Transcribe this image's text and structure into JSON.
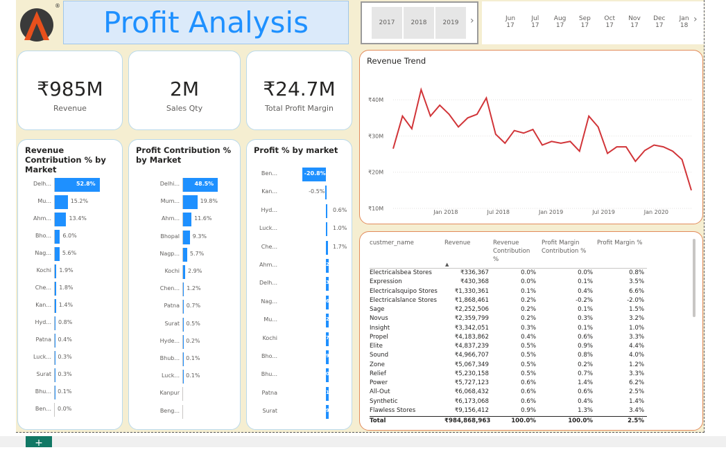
{
  "header": {
    "title": "Profit Analysis",
    "logo_letter": "A",
    "logo_mark": "®"
  },
  "year_slicer": {
    "years": [
      "2017",
      "2018",
      "2019"
    ],
    "next_icon": "chevron-right-icon"
  },
  "month_slicer": {
    "months": [
      [
        "Jun",
        "17"
      ],
      [
        "Jul",
        "17"
      ],
      [
        "Aug",
        "17"
      ],
      [
        "Sep",
        "17"
      ],
      [
        "Oct",
        "17"
      ],
      [
        "Nov",
        "17"
      ],
      [
        "Dec",
        "17"
      ],
      [
        "Jan",
        "18"
      ]
    ],
    "next_icon": "chevron-right-icon"
  },
  "kpis": [
    {
      "value": "₹985M",
      "label": "Revenue"
    },
    {
      "value": "2M",
      "label": "Sales Qty"
    },
    {
      "value": "₹24.7M",
      "label": "Total Profit Margin"
    }
  ],
  "revenue_contribution": {
    "title": "Revenue Contribution % by Market",
    "categories": [
      "Delh...",
      "Mu...",
      "Ahm...",
      "Bho...",
      "Nag...",
      "Kochi",
      "Che...",
      "Kan...",
      "Hyd...",
      "Patna",
      "Luck...",
      "Surat",
      "Bhu...",
      "Ben..."
    ],
    "labels": [
      "52.8%",
      "15.2%",
      "13.4%",
      "6.0%",
      "5.6%",
      "1.9%",
      "1.8%",
      "1.4%",
      "0.8%",
      "0.4%",
      "0.3%",
      "0.3%",
      "0.1%",
      "0.0%"
    ],
    "values": [
      52.8,
      15.2,
      13.4,
      6.0,
      5.6,
      1.9,
      1.8,
      1.4,
      0.8,
      0.4,
      0.3,
      0.3,
      0.1,
      0.0
    ]
  },
  "profit_contribution": {
    "title": "Profit Contribution % by Market",
    "categories": [
      "Delhi...",
      "Mum...",
      "Ahm...",
      "Bhopal",
      "Nagp...",
      "Kochi",
      "Chen...",
      "Patna",
      "Surat",
      "Hyde...",
      "Bhub...",
      "Luck...",
      "Kanpur",
      "Beng..."
    ],
    "labels": [
      "48.5%",
      "19.8%",
      "11.6%",
      "9.3%",
      "5.7%",
      "2.9%",
      "1.2%",
      "0.7%",
      "0.5%",
      "0.2%",
      "0.1%",
      "0.1%",
      "",
      ""
    ],
    "values": [
      48.5,
      19.8,
      11.6,
      9.3,
      5.7,
      2.9,
      1.2,
      0.7,
      0.5,
      0.2,
      0.1,
      0.1,
      0,
      0
    ]
  },
  "profit_pct": {
    "title": "Profit % by market",
    "categories": [
      "Ben...",
      "Kan...",
      "Hyd...",
      "Luck...",
      "Che...",
      "Ahm...",
      "Delh...",
      "Nag...",
      "Mu...",
      "Kochi",
      "Bho...",
      "Bhu...",
      "Patna",
      "Surat"
    ],
    "labels": [
      "-20.8%",
      "-0.5%",
      "0.6%",
      "1.0%",
      "1.7%",
      "2",
      "3",
      "6",
      "2",
      "7",
      "9",
      "0",
      "1",
      "9"
    ],
    "values": [
      -20.8,
      -0.5,
      0.6,
      1.0,
      1.7,
      2.0,
      3.0,
      6.0,
      2.0,
      7.0,
      9.0,
      10.0,
      11.0,
      9.0
    ]
  },
  "chart_data": {
    "type": "line",
    "title": "Revenue Trend",
    "y_ticks": [
      "₹10M",
      "₹20M",
      "₹30M",
      "₹40M"
    ],
    "x_ticks": [
      "Jan 2018",
      "Jul 2018",
      "Jan 2019",
      "Jul 2019",
      "Jan 2020"
    ],
    "x_tick_months": [
      7,
      13,
      19,
      25,
      31
    ],
    "ylim": [
      10,
      45
    ],
    "color": "#d13438",
    "x": [
      1,
      2,
      3,
      4,
      5,
      6,
      7,
      8,
      9,
      10,
      11,
      12,
      13,
      14,
      15,
      16,
      17,
      18,
      19,
      20,
      21,
      22,
      23,
      24,
      25,
      26,
      27,
      28,
      29,
      30,
      31,
      32,
      33,
      34,
      35
    ],
    "values": [
      26.5,
      35.5,
      32.0,
      42.8,
      35.5,
      38.5,
      36.0,
      32.5,
      35.0,
      36.0,
      40.5,
      30.5,
      28.0,
      31.5,
      30.8,
      31.8,
      27.5,
      28.5,
      28.0,
      28.5,
      25.8,
      35.5,
      32.5,
      25.2,
      27.0,
      27.0,
      23.0,
      26.0,
      27.5,
      27.0,
      25.8,
      23.5,
      15.0
    ]
  },
  "table": {
    "headers": [
      "custmer_name",
      "Revenue",
      "Revenue Contribution %",
      "Profit Margin Contribution %",
      "Profit Margin %"
    ],
    "rows": [
      [
        "Electricalsbea Stores",
        "₹336,367",
        "0.0%",
        "0.0%",
        "0.8%"
      ],
      [
        "Expression",
        "₹430,368",
        "0.0%",
        "0.1%",
        "3.5%"
      ],
      [
        "Electricalsquipo Stores",
        "₹1,330,361",
        "0.1%",
        "0.4%",
        "6.6%"
      ],
      [
        "Electricalslance Stores",
        "₹1,868,461",
        "0.2%",
        "-0.2%",
        "-2.0%"
      ],
      [
        "Sage",
        "₹2,252,506",
        "0.2%",
        "0.1%",
        "1.5%"
      ],
      [
        "Novus",
        "₹2,359,799",
        "0.2%",
        "0.3%",
        "3.2%"
      ],
      [
        "Insight",
        "₹3,342,051",
        "0.3%",
        "0.1%",
        "1.0%"
      ],
      [
        "Propel",
        "₹4,183,862",
        "0.4%",
        "0.6%",
        "3.3%"
      ],
      [
        "Elite",
        "₹4,837,239",
        "0.5%",
        "0.9%",
        "4.4%"
      ],
      [
        "Sound",
        "₹4,966,707",
        "0.5%",
        "0.8%",
        "4.0%"
      ],
      [
        "Zone",
        "₹5,067,349",
        "0.5%",
        "0.2%",
        "1.2%"
      ],
      [
        "Relief",
        "₹5,230,158",
        "0.5%",
        "0.7%",
        "3.3%"
      ],
      [
        "Power",
        "₹5,727,123",
        "0.6%",
        "1.4%",
        "6.2%"
      ],
      [
        "All-Out",
        "₹6,068,432",
        "0.6%",
        "0.6%",
        "2.5%"
      ],
      [
        "Synthetic",
        "₹6,173,068",
        "0.6%",
        "0.4%",
        "1.4%"
      ],
      [
        "Flawless Stores",
        "₹9,156,412",
        "0.9%",
        "1.3%",
        "3.4%"
      ]
    ],
    "total": [
      "Total",
      "₹984,868,963",
      "100.0%",
      "100.0%",
      "2.5%"
    ]
  },
  "statusbar": {
    "add_label": "+"
  }
}
